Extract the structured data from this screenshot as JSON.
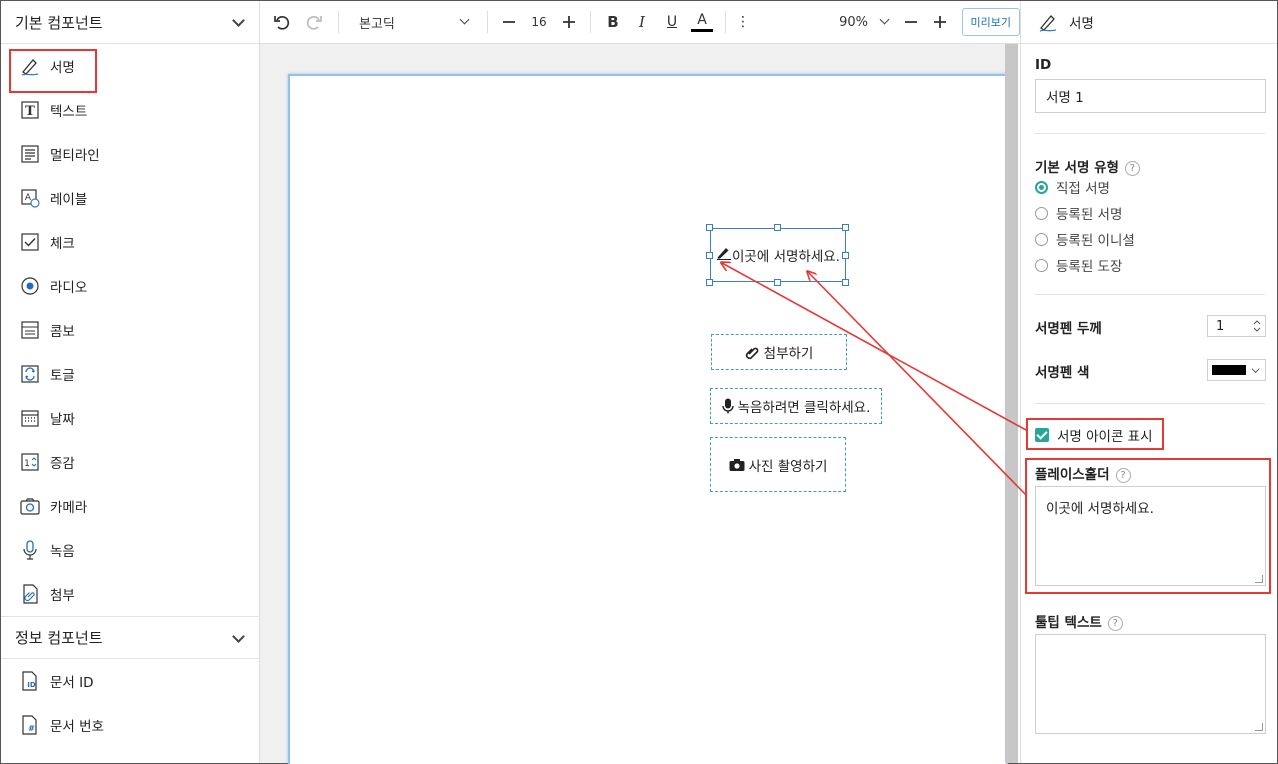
{
  "left_panel": {
    "basic_section": {
      "title": "기본 컴포넌트",
      "items": [
        {
          "label": "서명",
          "icon": "signature-icon"
        },
        {
          "label": "텍스트",
          "icon": "text-icon"
        },
        {
          "label": "멀티라인",
          "icon": "multiline-icon"
        },
        {
          "label": "레이블",
          "icon": "label-icon"
        },
        {
          "label": "체크",
          "icon": "checkbox-icon"
        },
        {
          "label": "라디오",
          "icon": "radio-icon"
        },
        {
          "label": "콤보",
          "icon": "combo-icon"
        },
        {
          "label": "토글",
          "icon": "toggle-icon"
        },
        {
          "label": "날짜",
          "icon": "calendar-icon"
        },
        {
          "label": "증감",
          "icon": "stepper-icon"
        },
        {
          "label": "카메라",
          "icon": "camera-icon"
        },
        {
          "label": "녹음",
          "icon": "microphone-icon"
        },
        {
          "label": "첨부",
          "icon": "attachment-icon"
        }
      ]
    },
    "info_section": {
      "title": "정보 컴포넌트",
      "items": [
        {
          "label": "문서 ID",
          "icon": "document-id-icon",
          "icon_text": "ID"
        },
        {
          "label": "문서 번호",
          "icon": "document-number-icon",
          "icon_text": "#"
        }
      ]
    }
  },
  "toolbar": {
    "font_family": "본고딕",
    "font_size": "16",
    "zoom": "90%",
    "preview_label": "미리보기",
    "bold": "B",
    "italic": "I",
    "underline": "U",
    "color": "A",
    "more": "⋮"
  },
  "canvas": {
    "signature_field": {
      "placeholder": "이곳에 서명하세요."
    },
    "attach_field": {
      "label": "첨부하기"
    },
    "record_field": {
      "label": "녹음하려면 클릭하세요."
    },
    "camera_field": {
      "label": "사진 촬영하기"
    }
  },
  "right_panel": {
    "header_title": "서명",
    "id_label": "ID",
    "id_value": "서명 1",
    "sig_type_label": "기본 서명 유형",
    "sig_type_options": [
      "직접 서명",
      "등록된 서명",
      "등록된 이니셜",
      "등록된 도장"
    ],
    "sig_type_selected": 0,
    "pen_width_label": "서명펜 두께",
    "pen_width_value": "1",
    "pen_color_label": "서명펜 색",
    "pen_color_value": "#000000",
    "show_icon_label": "서명 아이콘 표시",
    "show_icon_checked": true,
    "placeholder_label": "플레이스홀더",
    "placeholder_value": "이곳에 서명하세요.",
    "tooltip_label": "툴팁 텍스트",
    "tooltip_value": "",
    "help_mark": "?"
  },
  "colors": {
    "accent": "#26a69a",
    "highlight": "#e53935",
    "selection": "#3a7fbf",
    "page_border": "#8fc3ee"
  }
}
